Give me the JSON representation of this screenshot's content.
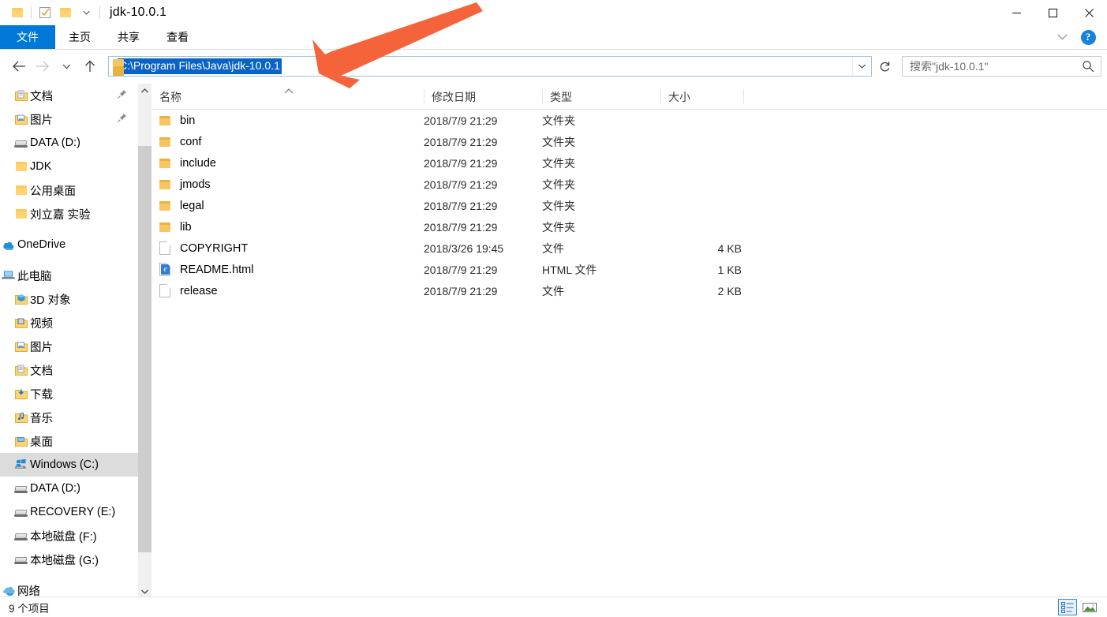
{
  "window": {
    "title": "jdk-10.0.1",
    "quick_access": [
      {
        "name": "folder-icon",
        "label": "属性"
      },
      {
        "name": "properties-checkbox-icon",
        "label": "属性"
      },
      {
        "name": "new-folder-icon",
        "label": "新建文件夹"
      },
      {
        "name": "chevron-down-icon",
        "label": "自定义快速访问工具栏"
      }
    ],
    "controls": {
      "minimize": "—",
      "maximize": "□",
      "close": "✕"
    }
  },
  "ribbon": {
    "tabs": [
      {
        "label": "文件",
        "active": true
      },
      {
        "label": "主页",
        "active": false
      },
      {
        "label": "共享",
        "active": false
      },
      {
        "label": "查看",
        "active": false
      }
    ],
    "expand_label": "展开功能区",
    "help_label": "?"
  },
  "nav": {
    "back_label": "后退",
    "forward_label": "前进",
    "recent_label": "最近浏览的位置",
    "up_label": "上移到",
    "address": {
      "value": "C:\\Program Files\\Java\\jdk-10.0.1",
      "selected": true,
      "dropdown_label": "浏览历史记录"
    },
    "refresh_label": "刷新",
    "search": {
      "placeholder": "搜索\"jdk-10.0.1\"",
      "icon": "search-icon"
    }
  },
  "sidebar": {
    "items": [
      {
        "label": "文档",
        "icon": "documents-folder-icon",
        "level": 2,
        "pinned": true,
        "selected": false
      },
      {
        "label": "图片",
        "icon": "pictures-folder-icon",
        "level": 2,
        "pinned": true,
        "selected": false
      },
      {
        "label": "DATA (D:)",
        "icon": "drive-icon",
        "level": 2,
        "pinned": false,
        "selected": false
      },
      {
        "label": "JDK",
        "icon": "folder-icon",
        "level": 2,
        "pinned": false,
        "selected": false
      },
      {
        "label": "公用桌面",
        "icon": "folder-icon",
        "level": 2,
        "pinned": false,
        "selected": false
      },
      {
        "label": "刘立嘉 实验",
        "icon": "folder-icon",
        "level": 2,
        "pinned": false,
        "selected": false
      },
      {
        "label": "OneDrive",
        "icon": "onedrive-cloud-icon",
        "level": 1,
        "pinned": false,
        "selected": false,
        "gap_before": true
      },
      {
        "label": "此电脑",
        "icon": "this-pc-icon",
        "level": 1,
        "pinned": false,
        "selected": false,
        "gap_before": true
      },
      {
        "label": "3D 对象",
        "icon": "3d-objects-icon",
        "level": 2,
        "pinned": false,
        "selected": false
      },
      {
        "label": "视频",
        "icon": "videos-folder-icon",
        "level": 2,
        "pinned": false,
        "selected": false
      },
      {
        "label": "图片",
        "icon": "pictures-folder-icon",
        "level": 2,
        "pinned": false,
        "selected": false
      },
      {
        "label": "文档",
        "icon": "documents-folder-icon",
        "level": 2,
        "pinned": false,
        "selected": false
      },
      {
        "label": "下载",
        "icon": "downloads-folder-icon",
        "level": 2,
        "pinned": false,
        "selected": false
      },
      {
        "label": "音乐",
        "icon": "music-folder-icon",
        "level": 2,
        "pinned": false,
        "selected": false
      },
      {
        "label": "桌面",
        "icon": "desktop-folder-icon",
        "level": 2,
        "pinned": false,
        "selected": false
      },
      {
        "label": "Windows (C:)",
        "icon": "windows-drive-icon",
        "level": 2,
        "pinned": false,
        "selected": true
      },
      {
        "label": "DATA (D:)",
        "icon": "drive-icon",
        "level": 2,
        "pinned": false,
        "selected": false
      },
      {
        "label": "RECOVERY (E:)",
        "icon": "drive-icon",
        "level": 2,
        "pinned": false,
        "selected": false
      },
      {
        "label": "本地磁盘 (F:)",
        "icon": "drive-icon",
        "level": 2,
        "pinned": false,
        "selected": false
      },
      {
        "label": "本地磁盘 (G:)",
        "icon": "drive-icon",
        "level": 2,
        "pinned": false,
        "selected": false
      },
      {
        "label": "网络",
        "icon": "network-icon",
        "level": 1,
        "pinned": false,
        "selected": false,
        "gap_before": true
      }
    ]
  },
  "filelist": {
    "columns": [
      {
        "label": "名称",
        "sorted": "asc"
      },
      {
        "label": "修改日期",
        "sorted": ""
      },
      {
        "label": "类型",
        "sorted": ""
      },
      {
        "label": "大小",
        "sorted": ""
      }
    ],
    "rows": [
      {
        "name": "bin",
        "icon": "folder-icon",
        "date": "2018/7/9 21:29",
        "type": "文件夹",
        "size": ""
      },
      {
        "name": "conf",
        "icon": "folder-icon",
        "date": "2018/7/9 21:29",
        "type": "文件夹",
        "size": ""
      },
      {
        "name": "include",
        "icon": "folder-icon",
        "date": "2018/7/9 21:29",
        "type": "文件夹",
        "size": ""
      },
      {
        "name": "jmods",
        "icon": "folder-icon",
        "date": "2018/7/9 21:29",
        "type": "文件夹",
        "size": ""
      },
      {
        "name": "legal",
        "icon": "folder-icon",
        "date": "2018/7/9 21:29",
        "type": "文件夹",
        "size": ""
      },
      {
        "name": "lib",
        "icon": "folder-icon",
        "date": "2018/7/9 21:29",
        "type": "文件夹",
        "size": ""
      },
      {
        "name": "COPYRIGHT",
        "icon": "file-icon",
        "date": "2018/3/26 19:45",
        "type": "文件",
        "size": "4 KB"
      },
      {
        "name": "README.html",
        "icon": "html-file-icon",
        "date": "2018/7/9 21:29",
        "type": "HTML 文件",
        "size": "1 KB"
      },
      {
        "name": "release",
        "icon": "file-icon",
        "date": "2018/7/9 21:29",
        "type": "文件",
        "size": "2 KB"
      }
    ]
  },
  "statusbar": {
    "item_count": "9 个项目",
    "views": [
      {
        "name": "details-view-button",
        "label": "详细信息",
        "active": true
      },
      {
        "name": "large-icons-view-button",
        "label": "大图标",
        "active": false
      }
    ]
  },
  "annotation": {
    "type": "arrow",
    "color": "#f4633a",
    "points_to": "address-bar"
  },
  "colors": {
    "accent": "#0078d7",
    "selection": "#0a64c8",
    "arrow": "#f4633a",
    "sidebar_selected": "#dcdcdc"
  }
}
